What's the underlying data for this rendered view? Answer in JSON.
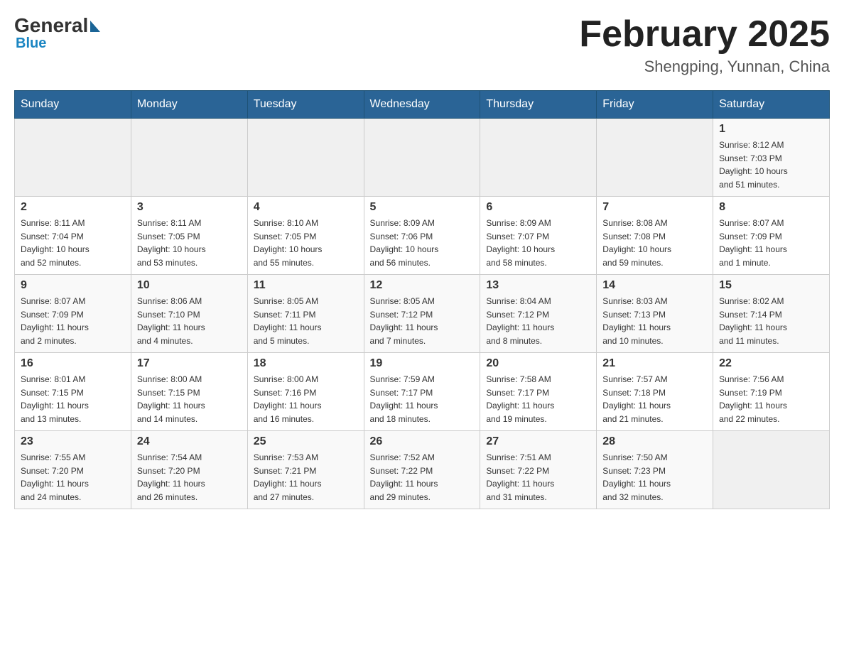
{
  "header": {
    "logo_general": "General",
    "logo_blue": "Blue",
    "month_title": "February 2025",
    "location": "Shengping, Yunnan, China"
  },
  "days_of_week": [
    "Sunday",
    "Monday",
    "Tuesday",
    "Wednesday",
    "Thursday",
    "Friday",
    "Saturday"
  ],
  "weeks": [
    [
      {
        "day": "",
        "info": ""
      },
      {
        "day": "",
        "info": ""
      },
      {
        "day": "",
        "info": ""
      },
      {
        "day": "",
        "info": ""
      },
      {
        "day": "",
        "info": ""
      },
      {
        "day": "",
        "info": ""
      },
      {
        "day": "1",
        "info": "Sunrise: 8:12 AM\nSunset: 7:03 PM\nDaylight: 10 hours\nand 51 minutes."
      }
    ],
    [
      {
        "day": "2",
        "info": "Sunrise: 8:11 AM\nSunset: 7:04 PM\nDaylight: 10 hours\nand 52 minutes."
      },
      {
        "day": "3",
        "info": "Sunrise: 8:11 AM\nSunset: 7:05 PM\nDaylight: 10 hours\nand 53 minutes."
      },
      {
        "day": "4",
        "info": "Sunrise: 8:10 AM\nSunset: 7:05 PM\nDaylight: 10 hours\nand 55 minutes."
      },
      {
        "day": "5",
        "info": "Sunrise: 8:09 AM\nSunset: 7:06 PM\nDaylight: 10 hours\nand 56 minutes."
      },
      {
        "day": "6",
        "info": "Sunrise: 8:09 AM\nSunset: 7:07 PM\nDaylight: 10 hours\nand 58 minutes."
      },
      {
        "day": "7",
        "info": "Sunrise: 8:08 AM\nSunset: 7:08 PM\nDaylight: 10 hours\nand 59 minutes."
      },
      {
        "day": "8",
        "info": "Sunrise: 8:07 AM\nSunset: 7:09 PM\nDaylight: 11 hours\nand 1 minute."
      }
    ],
    [
      {
        "day": "9",
        "info": "Sunrise: 8:07 AM\nSunset: 7:09 PM\nDaylight: 11 hours\nand 2 minutes."
      },
      {
        "day": "10",
        "info": "Sunrise: 8:06 AM\nSunset: 7:10 PM\nDaylight: 11 hours\nand 4 minutes."
      },
      {
        "day": "11",
        "info": "Sunrise: 8:05 AM\nSunset: 7:11 PM\nDaylight: 11 hours\nand 5 minutes."
      },
      {
        "day": "12",
        "info": "Sunrise: 8:05 AM\nSunset: 7:12 PM\nDaylight: 11 hours\nand 7 minutes."
      },
      {
        "day": "13",
        "info": "Sunrise: 8:04 AM\nSunset: 7:12 PM\nDaylight: 11 hours\nand 8 minutes."
      },
      {
        "day": "14",
        "info": "Sunrise: 8:03 AM\nSunset: 7:13 PM\nDaylight: 11 hours\nand 10 minutes."
      },
      {
        "day": "15",
        "info": "Sunrise: 8:02 AM\nSunset: 7:14 PM\nDaylight: 11 hours\nand 11 minutes."
      }
    ],
    [
      {
        "day": "16",
        "info": "Sunrise: 8:01 AM\nSunset: 7:15 PM\nDaylight: 11 hours\nand 13 minutes."
      },
      {
        "day": "17",
        "info": "Sunrise: 8:00 AM\nSunset: 7:15 PM\nDaylight: 11 hours\nand 14 minutes."
      },
      {
        "day": "18",
        "info": "Sunrise: 8:00 AM\nSunset: 7:16 PM\nDaylight: 11 hours\nand 16 minutes."
      },
      {
        "day": "19",
        "info": "Sunrise: 7:59 AM\nSunset: 7:17 PM\nDaylight: 11 hours\nand 18 minutes."
      },
      {
        "day": "20",
        "info": "Sunrise: 7:58 AM\nSunset: 7:17 PM\nDaylight: 11 hours\nand 19 minutes."
      },
      {
        "day": "21",
        "info": "Sunrise: 7:57 AM\nSunset: 7:18 PM\nDaylight: 11 hours\nand 21 minutes."
      },
      {
        "day": "22",
        "info": "Sunrise: 7:56 AM\nSunset: 7:19 PM\nDaylight: 11 hours\nand 22 minutes."
      }
    ],
    [
      {
        "day": "23",
        "info": "Sunrise: 7:55 AM\nSunset: 7:20 PM\nDaylight: 11 hours\nand 24 minutes."
      },
      {
        "day": "24",
        "info": "Sunrise: 7:54 AM\nSunset: 7:20 PM\nDaylight: 11 hours\nand 26 minutes."
      },
      {
        "day": "25",
        "info": "Sunrise: 7:53 AM\nSunset: 7:21 PM\nDaylight: 11 hours\nand 27 minutes."
      },
      {
        "day": "26",
        "info": "Sunrise: 7:52 AM\nSunset: 7:22 PM\nDaylight: 11 hours\nand 29 minutes."
      },
      {
        "day": "27",
        "info": "Sunrise: 7:51 AM\nSunset: 7:22 PM\nDaylight: 11 hours\nand 31 minutes."
      },
      {
        "day": "28",
        "info": "Sunrise: 7:50 AM\nSunset: 7:23 PM\nDaylight: 11 hours\nand 32 minutes."
      },
      {
        "day": "",
        "info": ""
      }
    ]
  ]
}
